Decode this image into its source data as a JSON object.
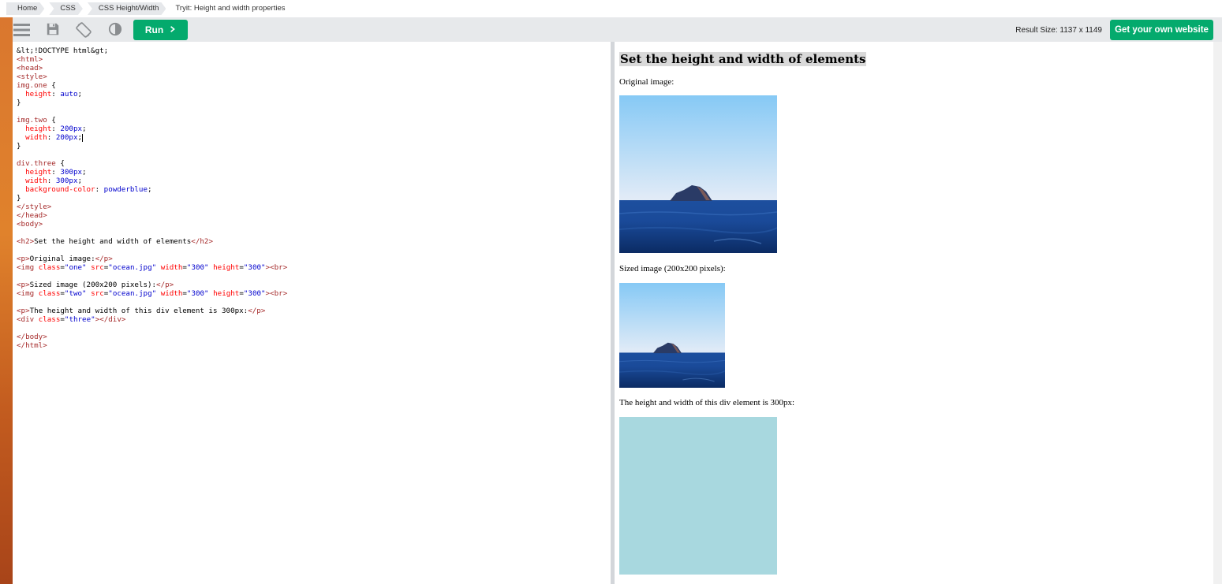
{
  "breadcrumbs": [
    "Home",
    "CSS",
    "CSS Height/Width",
    "Tryit: Height and width properties"
  ],
  "toolbar": {
    "run_label": "Run",
    "result_size": "Result Size: 1137 x 1149",
    "own_website_label": "Get your own website"
  },
  "code_lines": [
    "<!DOCTYPE html>",
    "<html>",
    "<head>",
    "<style>",
    "img.one {",
    "  height: auto;",
    "}",
    "",
    "img.two {",
    "  height: 200px;",
    "  width: 200px;",
    "}",
    "",
    "div.three {",
    "  height: 300px;",
    "  width: 300px;",
    "  background-color: powderblue;",
    "}",
    "</style>",
    "</head>",
    "<body>",
    "",
    "<h2>Set the height and width of elements</h2>",
    "",
    "<p>Original image:</p>",
    "<img class=\"one\" src=\"ocean.jpg\" width=\"300\" height=\"300\"><br>",
    "",
    "<p>Sized image (200x200 pixels):</p>",
    "<img class=\"two\" src=\"ocean.jpg\" width=\"300\" height=\"300\"><br>",
    "",
    "<p>The height and width of this div element is 300px:</p>",
    "<div class=\"three\"></div>",
    "",
    "</body>",
    "</html>"
  ],
  "result": {
    "heading": "Set the height and width of elements",
    "p_original": "Original image:",
    "p_sized": "Sized image (200x200 pixels):",
    "p_div": "The height and width of this div element is 300px:"
  },
  "colors": {
    "brand_green": "#04aa6d",
    "powderblue": "#b0e0e6"
  },
  "icons": [
    "menu-icon",
    "save-icon",
    "rotate-orientation-icon",
    "contrast-icon",
    "chevron-right-icon"
  ]
}
